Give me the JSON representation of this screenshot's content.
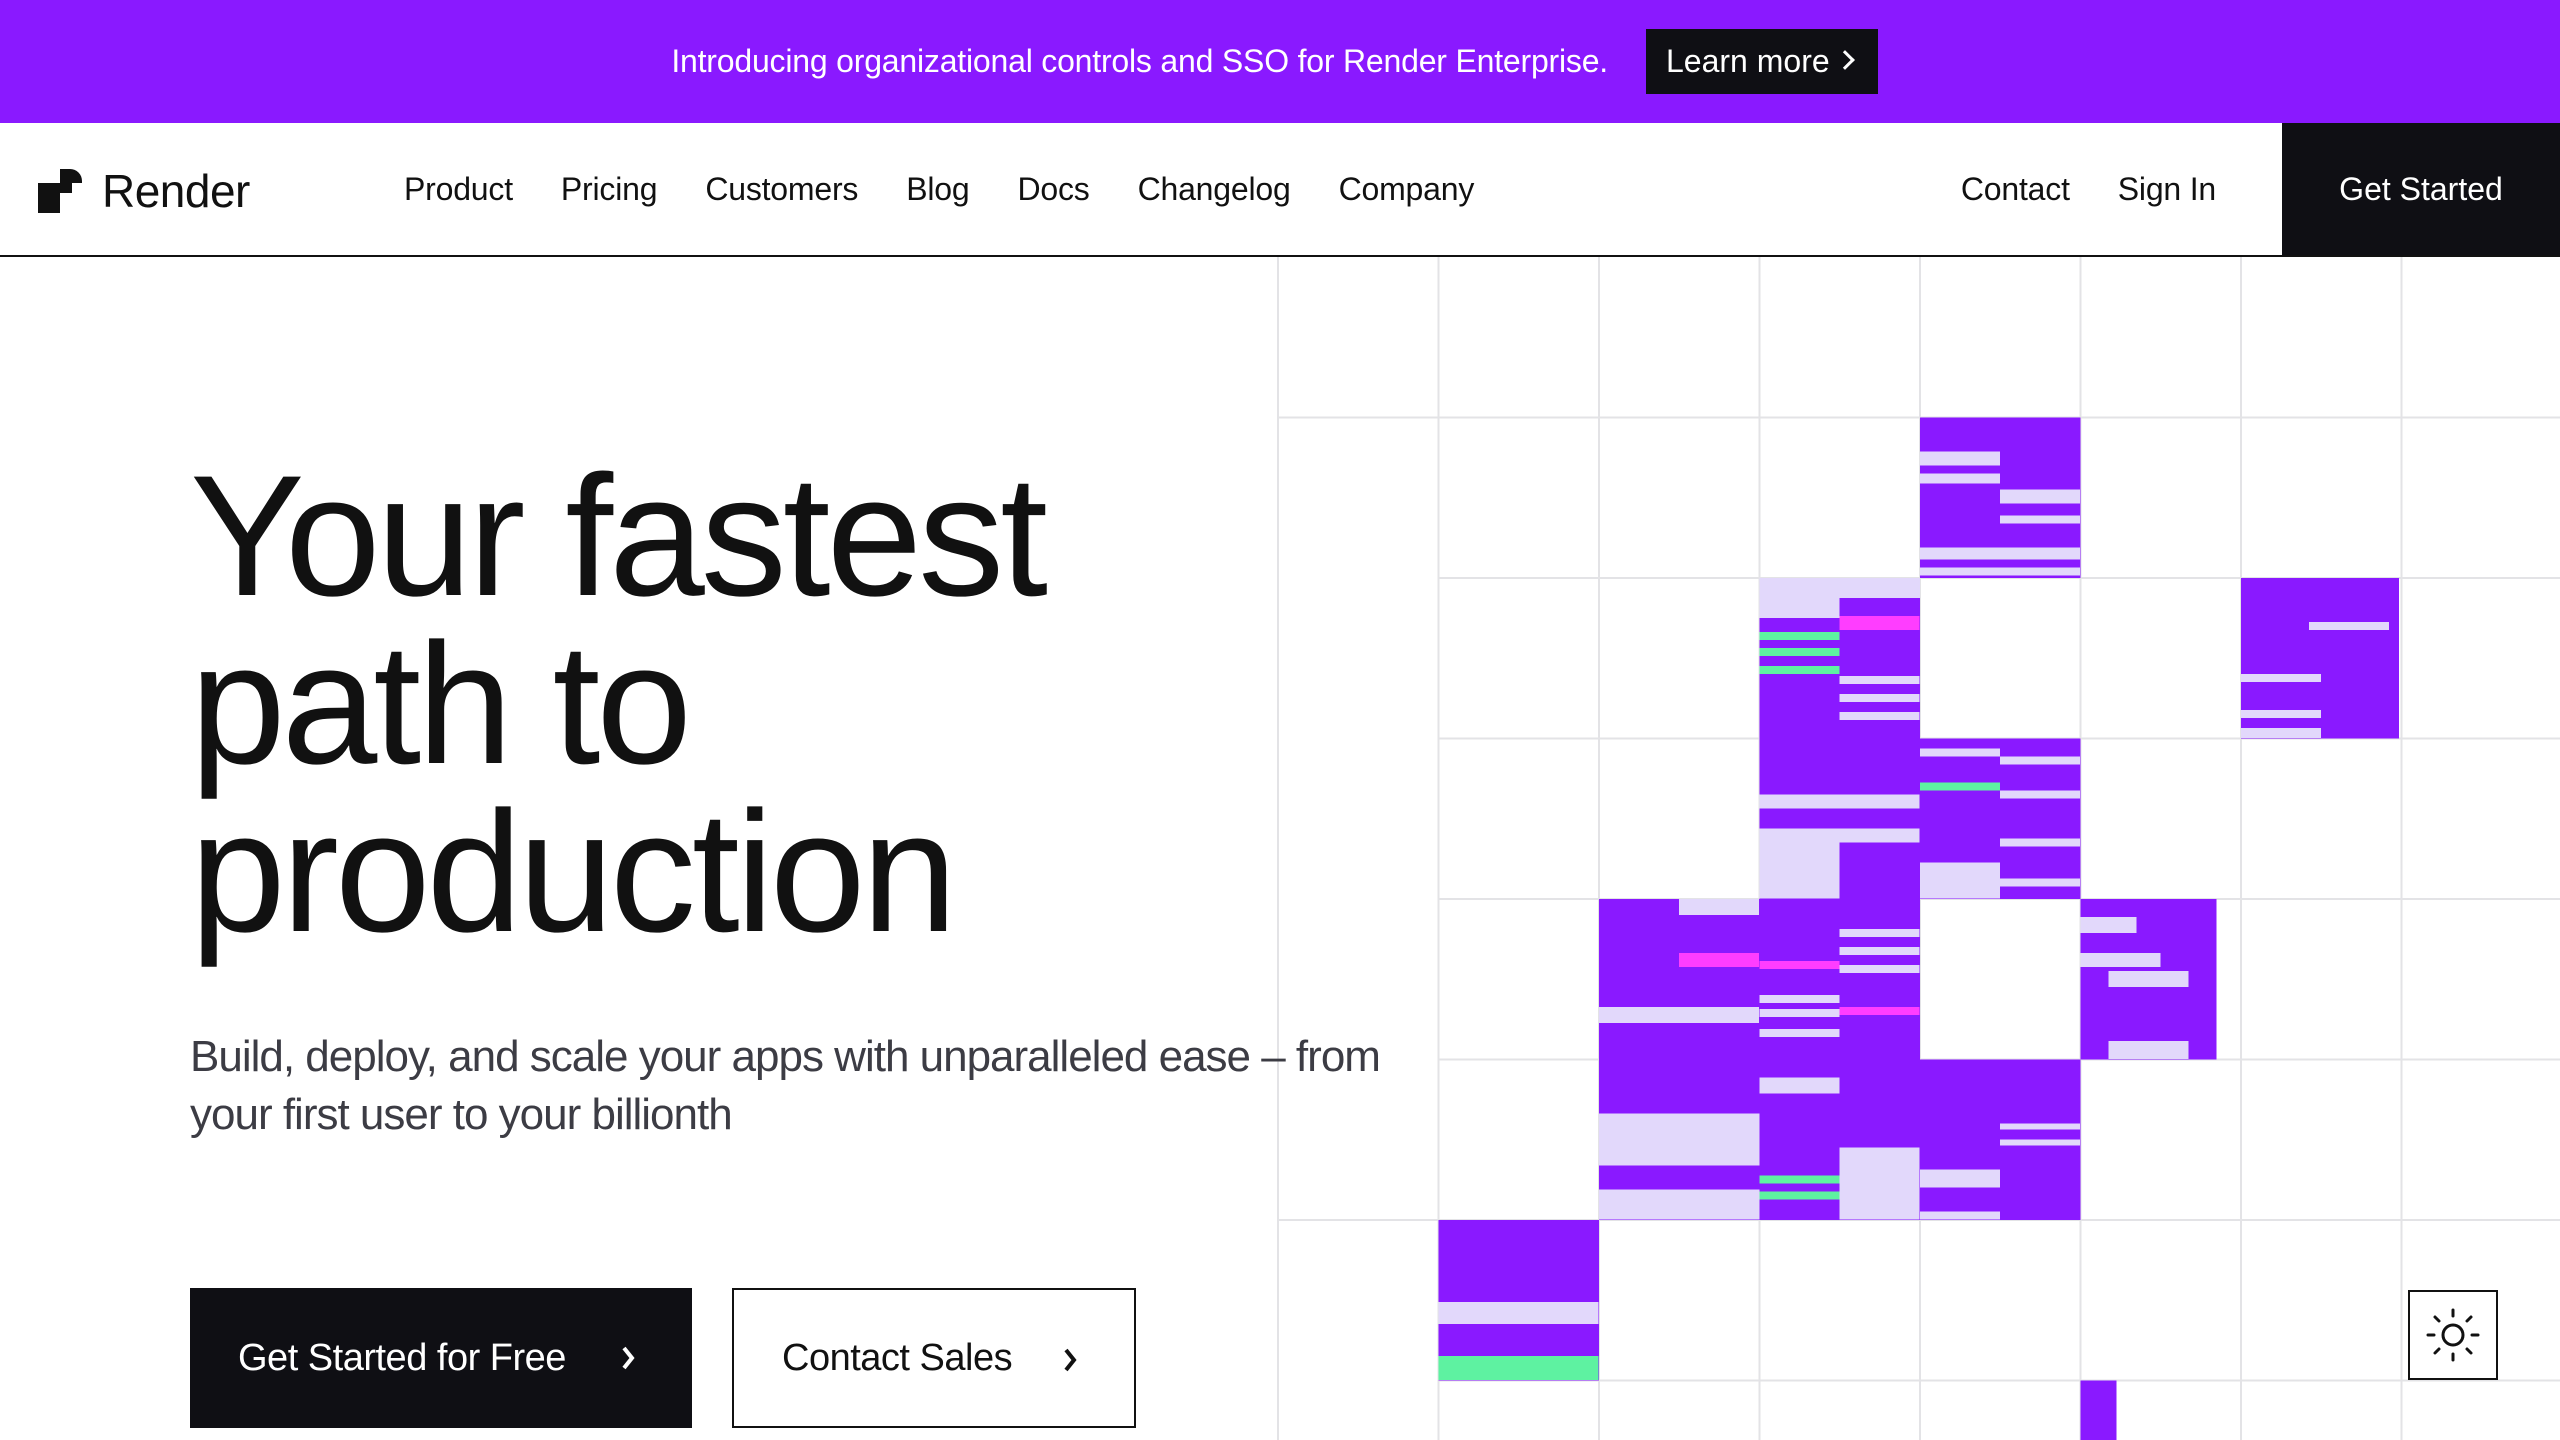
{
  "banner": {
    "text": "Introducing organizational controls and SSO for Render Enterprise.",
    "link_label": "Learn more",
    "background": "#8a19ff"
  },
  "nav": {
    "brand": "Render",
    "links": [
      "Product",
      "Pricing",
      "Customers",
      "Blog",
      "Docs",
      "Changelog",
      "Company"
    ],
    "right_links": [
      "Contact",
      "Sign In"
    ],
    "cta": "Get Started"
  },
  "hero": {
    "title_lines": [
      "Your fastest",
      "path to",
      "production"
    ],
    "subtitle_lines": [
      "Build, deploy, and scale your apps with unparalleled ease – from",
      "your first user to your billionth"
    ],
    "primary_button": "Get Started for Free",
    "secondary_button": "Contact Sales"
  },
  "icons": {
    "logo": "render-logo-icon",
    "banner_chevron": "chevron-right-icon",
    "button_arrow": "chevron-right-icon",
    "theme": "sun-icon"
  },
  "colors": {
    "accent_purple": "#8a19ff",
    "light_purple": "#e2d8fb",
    "magenta": "#ff3dff",
    "mint": "#5ef2a1",
    "dark": "#0f0f14"
  }
}
